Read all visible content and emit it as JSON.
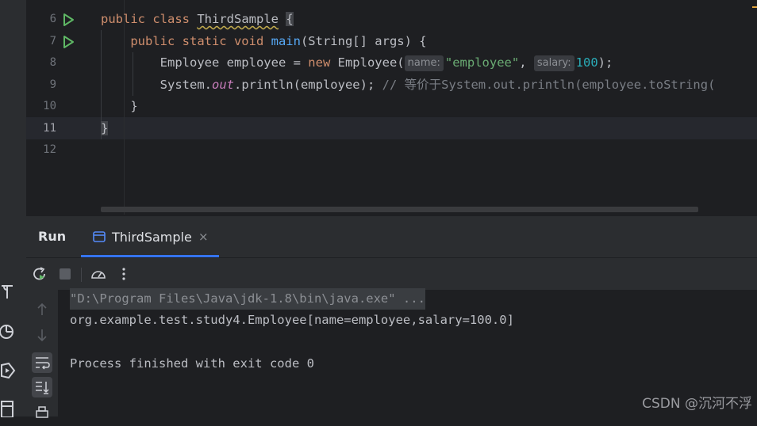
{
  "editor": {
    "line_numbers": [
      "6",
      "7",
      "8",
      "9",
      "10",
      "11",
      "12"
    ],
    "current_line": "11",
    "code": {
      "l6": {
        "kw": "public class ",
        "class_name": "ThirdSample",
        "rest": " ",
        "brace": "{"
      },
      "l7": {
        "indent": "    ",
        "kw": "public static void ",
        "method": "main",
        "rest": "(String[] args) {"
      },
      "l8": {
        "indent": "        ",
        "pre": "Employee employee = ",
        "kw": "new",
        "mid": " Employee(",
        "hint1": "name:",
        "str": "\"employee\"",
        "comma": ", ",
        "hint2": "salary:",
        "num": "100",
        "end": ");"
      },
      "l9": {
        "indent": "        ",
        "pre": "System.",
        "field": "out",
        "mid": ".println(employee); ",
        "comment": "// 等价于System.out.println(employee.toString("
      },
      "l10": {
        "indent": "    ",
        "text": "}"
      },
      "l11": {
        "brace": "}"
      }
    }
  },
  "run_window": {
    "title": "Run",
    "tab_label": "ThirdSample",
    "tab_close": "×",
    "console_lines": [
      "\"D:\\Program Files\\Java\\jdk-1.8\\bin\\java.exe\" ...",
      "org.example.test.study4.Employee[name=employee,salary=100.0]",
      "",
      "Process finished with exit code 0"
    ]
  },
  "watermark": "CSDN @沉河不浮",
  "icons": {
    "gutter_run": "run-triangle-icon",
    "toolbar": [
      "rerun-icon",
      "stop-icon",
      "profiler-icon",
      "more-options-icon"
    ],
    "side": [
      "arrow-up-icon",
      "arrow-down-icon",
      "soft-wrap-icon",
      "scroll-to-end-icon",
      "print-icon"
    ],
    "left_strip": [
      "build-icon",
      "profiler-icon",
      "services-icon",
      "terminal-icon"
    ]
  },
  "colors": {
    "accent": "#3574f0",
    "keyword": "#cf8e6d",
    "string": "#6aab73",
    "number": "#2aacb8",
    "method": "#56a8f5",
    "run_green": "#5fb865"
  }
}
